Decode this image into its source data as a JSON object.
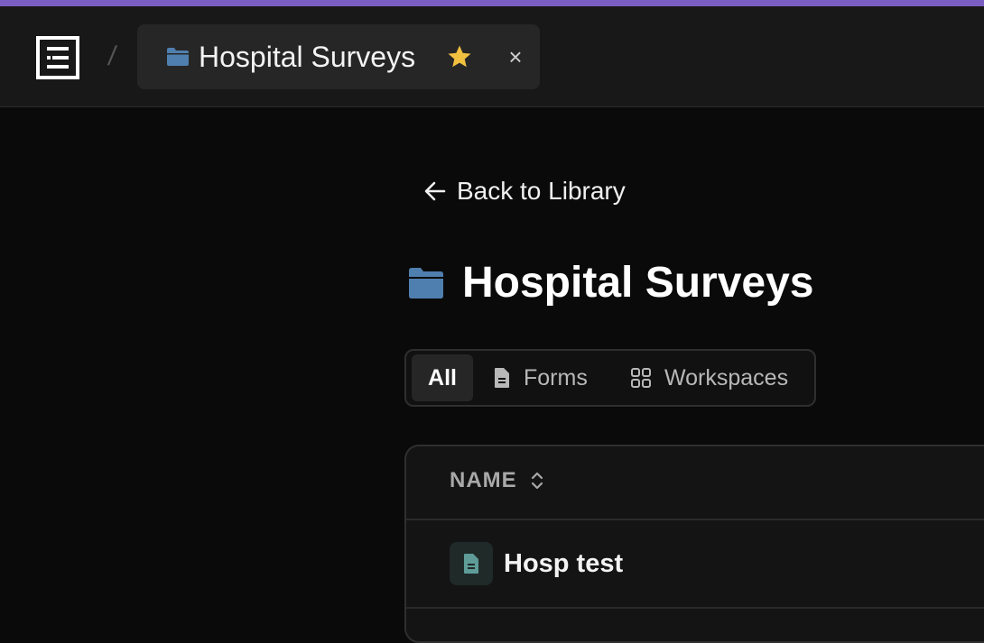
{
  "colors": {
    "accent_bar": "#7b5ec4",
    "folder": "#4f7fae",
    "star": "#f0c040",
    "doc_icon": "#5f9c98"
  },
  "topbar": {
    "logo_icon": "document-grid-logo",
    "separator": "/",
    "tab": {
      "icon": "folder-icon",
      "title": "Hospital Surveys",
      "favorite_icon": "star-icon",
      "close_label": "×"
    }
  },
  "main": {
    "back_link": {
      "icon": "arrow-left-icon",
      "label": "Back to Library"
    },
    "title": {
      "icon": "folder-icon",
      "text": "Hospital Surveys"
    },
    "filters": [
      {
        "label": "All",
        "icon": "",
        "active": true
      },
      {
        "label": "Forms",
        "icon": "document-icon",
        "active": false
      },
      {
        "label": "Workspaces",
        "icon": "grid-icon",
        "active": false
      }
    ],
    "table": {
      "columns": [
        {
          "label": "NAME",
          "icon": "sort-icon"
        }
      ],
      "rows": [
        {
          "icon": "document-icon",
          "name": "Hosp test"
        }
      ]
    }
  }
}
